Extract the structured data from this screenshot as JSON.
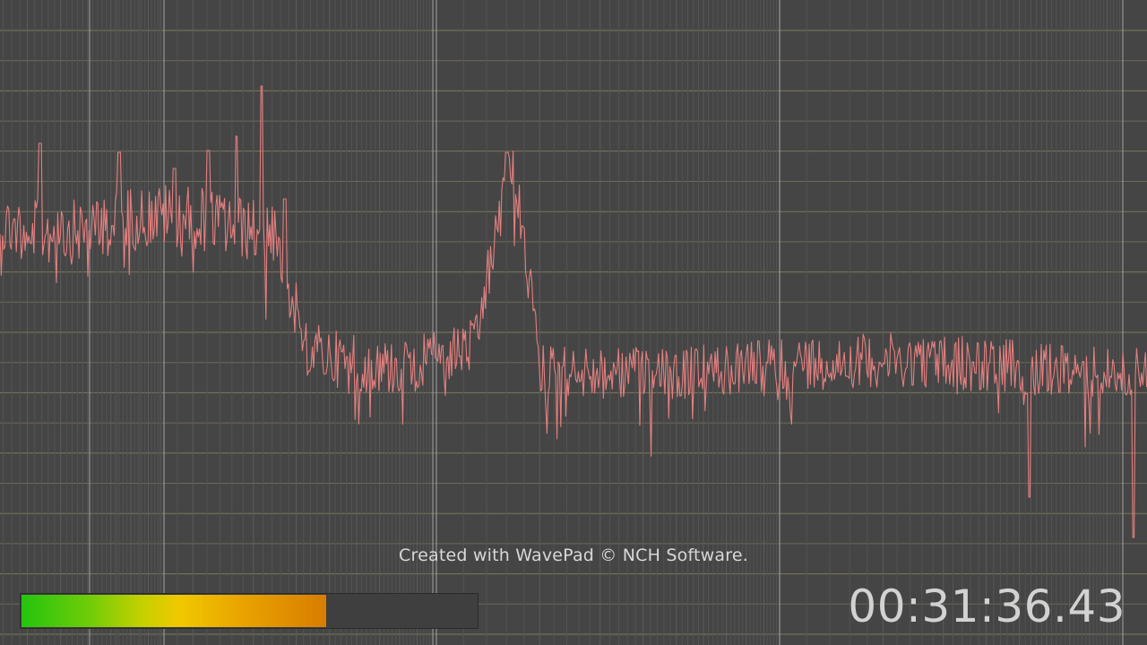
{
  "watermark": "Created with WavePad © NCH Software.",
  "timecode": "00:31:36.43",
  "level_meter": {
    "level": 0.67
  },
  "display": {
    "type": "frequency-spectrum",
    "grid": "log",
    "background_color": "#454545",
    "trace_color": "#e47f7f"
  }
}
